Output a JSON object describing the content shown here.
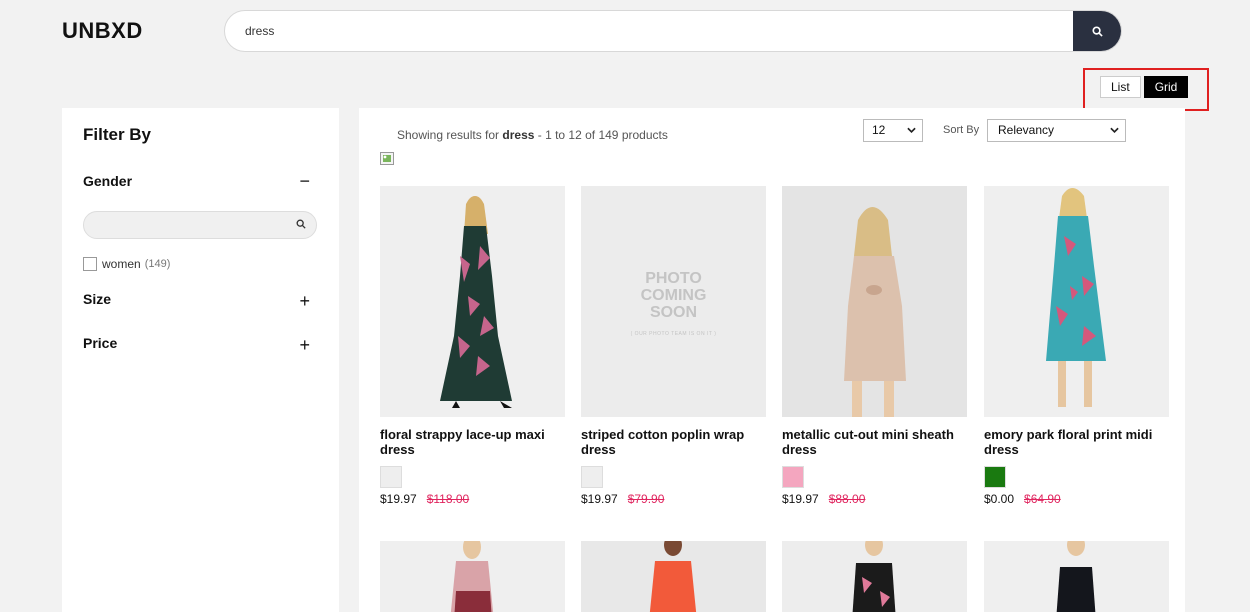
{
  "header": {
    "logo": "UNBXD",
    "search_value": "dress",
    "search_icon": "search-icon"
  },
  "view_toggle": {
    "list_label": "List",
    "grid_label": "Grid",
    "active": "Grid",
    "highlight_color": "#e02020"
  },
  "sidebar": {
    "title": "Filter By",
    "facets": [
      {
        "label": "Gender",
        "toggle": "−",
        "options": [
          {
            "label": "women",
            "count": "(149)"
          }
        ]
      },
      {
        "label": "Size",
        "toggle": "+"
      },
      {
        "label": "Price",
        "toggle": "+"
      }
    ]
  },
  "results": {
    "prefix": "Showing results for ",
    "query": "dress",
    "suffix": " - 1 to 12 of 149 products",
    "per_page": "12",
    "sort_label": "Sort By",
    "sort_value": "Relevancy"
  },
  "products": [
    {
      "name": "floral strappy lace-up maxi dress",
      "price": "$19.97",
      "old_price": "$118.00",
      "swatch": "#eeeeee",
      "image": "woman in floral lace maxi dress"
    },
    {
      "name": "striped cotton poplin wrap dress",
      "price": "$19.97",
      "old_price": "$79.90",
      "swatch": "#eeeeee",
      "image": "photo coming soon placeholder",
      "placeholder_text": "PHOTO COMING SOON",
      "placeholder_sub": "( OUR PHOTO TEAM IS ON IT )"
    },
    {
      "name": "metallic cut-out mini sheath dress",
      "price": "$19.97",
      "old_price": "$88.00",
      "swatch": "#f4a6bf",
      "image": "woman in beige cut-out mini dress"
    },
    {
      "name": "emory park floral print midi dress",
      "price": "$0.00",
      "old_price": "$64.90",
      "swatch": "#1a7a10",
      "image": "woman in teal floral midi dress"
    }
  ],
  "colors": {
    "accent": "#2a3040",
    "sale": "#e0245e",
    "background": "#f2f2f2"
  }
}
